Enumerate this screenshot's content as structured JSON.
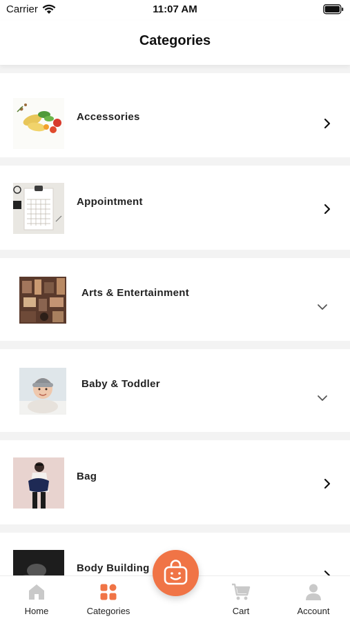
{
  "status_bar": {
    "carrier": "Carrier",
    "time": "11:07 AM"
  },
  "header": {
    "title": "Categories"
  },
  "categories": [
    {
      "label": "Accessories",
      "icon": "chevron-right-icon"
    },
    {
      "label": "Appointment",
      "icon": "chevron-right-icon"
    },
    {
      "label": "Arts & Entertainment",
      "icon": "chevron-down-icon"
    },
    {
      "label": "Baby & Toddler",
      "icon": "chevron-down-icon"
    },
    {
      "label": "Bag",
      "icon": "chevron-right-icon"
    },
    {
      "label": "Body Building",
      "icon": "chevron-right-icon"
    }
  ],
  "tab_bar": {
    "tabs": [
      {
        "label": "Home",
        "icon": "home-icon"
      },
      {
        "label": "Categories",
        "icon": "categories-grid-icon"
      },
      {
        "label": "Cart",
        "icon": "cart-icon"
      },
      {
        "label": "Account",
        "icon": "account-icon"
      }
    ],
    "active": "Categories",
    "fab_icon": "shopping-bag-icon"
  },
  "colors": {
    "accent": "#f07446",
    "inactive_icon": "#c9c9c9",
    "background": "#f3f3f3"
  }
}
